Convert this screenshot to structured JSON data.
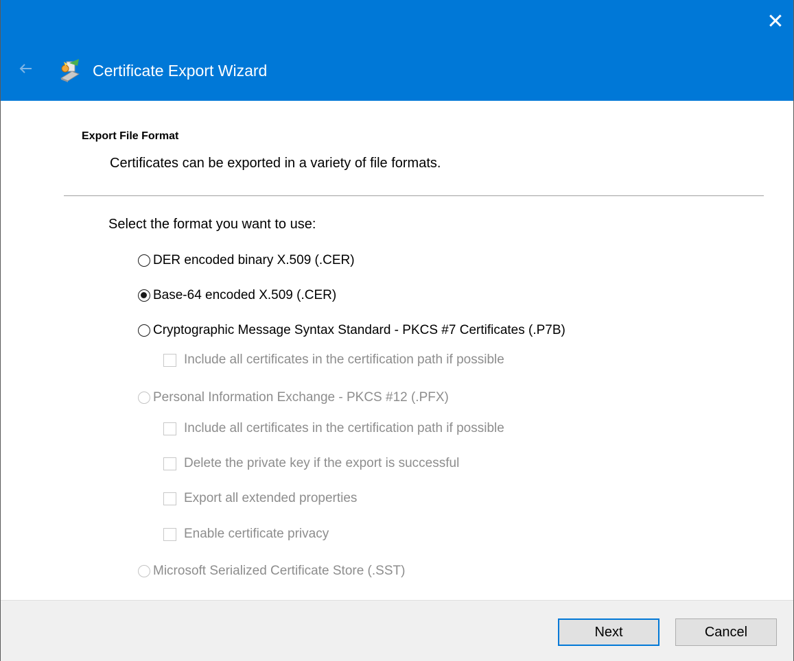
{
  "window": {
    "title": "Certificate Export Wizard",
    "close_label": "✕",
    "back_label": "Back"
  },
  "header": {
    "title": "Export File Format",
    "description": "Certificates can be exported in a variety of file formats."
  },
  "prompt": "Select the format you want to use:",
  "formats": [
    {
      "label": "DER encoded binary X.509 (.CER)",
      "selected": false,
      "enabled": true
    },
    {
      "label": "Base-64 encoded X.509 (.CER)",
      "selected": true,
      "enabled": true
    },
    {
      "label": "Cryptographic Message Syntax Standard - PKCS #7 Certificates (.P7B)",
      "selected": false,
      "enabled": true
    },
    {
      "label": "Personal Information Exchange - PKCS #12 (.PFX)",
      "selected": false,
      "enabled": false
    },
    {
      "label": "Microsoft Serialized Certificate Store (.SST)",
      "selected": false,
      "enabled": false
    }
  ],
  "p7b_options": [
    {
      "label": "Include all certificates in the certification path if possible",
      "checked": false,
      "enabled": false
    }
  ],
  "pfx_options": [
    {
      "label": "Include all certificates in the certification path if possible",
      "checked": false,
      "enabled": false
    },
    {
      "label": "Delete the private key if the export is successful",
      "checked": false,
      "enabled": false
    },
    {
      "label": "Export all extended properties",
      "checked": false,
      "enabled": false
    },
    {
      "label": "Enable certificate privacy",
      "checked": false,
      "enabled": false
    }
  ],
  "footer": {
    "next_label": "Next",
    "cancel_label": "Cancel"
  },
  "colors": {
    "titlebar": "#0078d7",
    "footer": "#f0f0f0",
    "disabled_text": "#8d8d8d",
    "focus_border": "#0078d7"
  },
  "icons": {
    "back": "back-arrow-icon",
    "wizard": "certificate-wizard-icon",
    "close": "close-icon"
  }
}
